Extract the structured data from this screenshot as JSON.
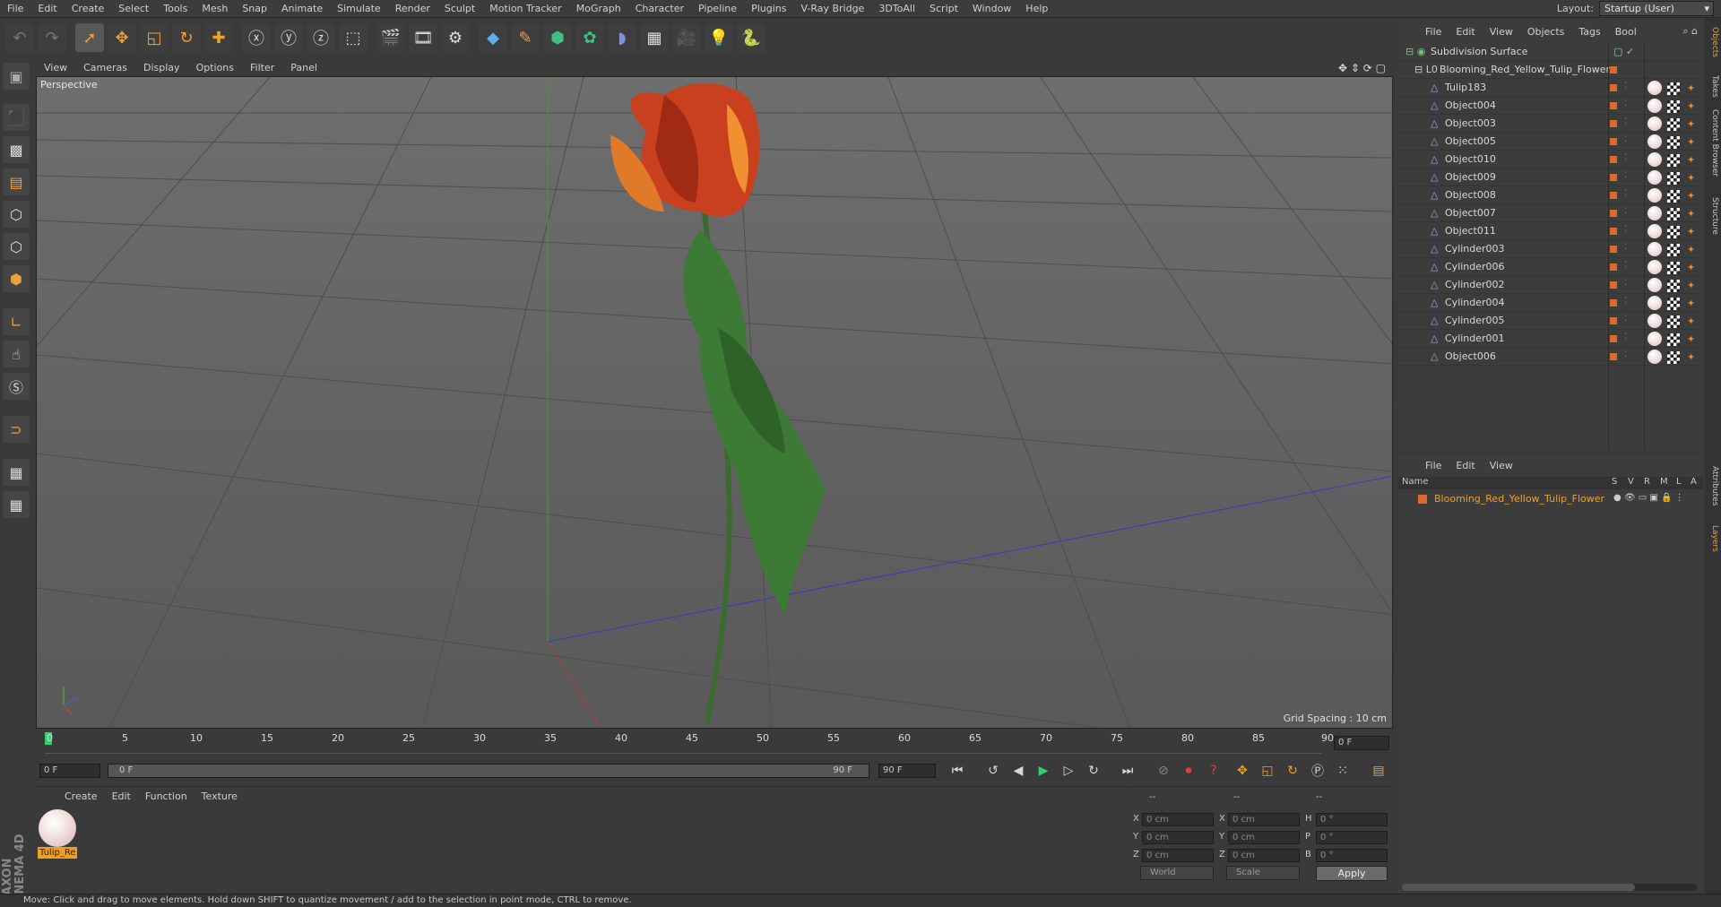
{
  "menubar": {
    "items": [
      "File",
      "Edit",
      "Create",
      "Select",
      "Tools",
      "Mesh",
      "Snap",
      "Animate",
      "Simulate",
      "Render",
      "Sculpt",
      "Motion Tracker",
      "MoGraph",
      "Character",
      "Pipeline",
      "Plugins",
      "V-Ray Bridge",
      "3DToAll",
      "Script",
      "Window",
      "Help"
    ],
    "layout_label": "Layout:",
    "layout_value": "Startup (User)"
  },
  "viewport": {
    "menu": [
      "View",
      "Cameras",
      "Display",
      "Options",
      "Filter",
      "Panel"
    ],
    "label": "Perspective",
    "grid_spacing": "Grid Spacing : 10 cm"
  },
  "timeline": {
    "ticks": [
      "0",
      "5",
      "10",
      "15",
      "20",
      "25",
      "30",
      "35",
      "40",
      "45",
      "50",
      "55",
      "60",
      "65",
      "70",
      "75",
      "80",
      "85",
      "90"
    ],
    "current_frame": "0 F",
    "start_field": "0 F",
    "range_start": "0 F",
    "range_end": "90 F",
    "end_field": "90 F"
  },
  "material_manager": {
    "menu": [
      "Create",
      "Edit",
      "Function",
      "Texture"
    ],
    "material_name": "Tulip_Re"
  },
  "coordinates": {
    "headers": [
      "--",
      "--",
      "--"
    ],
    "rows": [
      {
        "l1": "X",
        "v1": "0 cm",
        "l2": "X",
        "v2": "0 cm",
        "l3": "H",
        "v3": "0 °"
      },
      {
        "l1": "Y",
        "v1": "0 cm",
        "l2": "Y",
        "v2": "0 cm",
        "l3": "P",
        "v3": "0 °"
      },
      {
        "l1": "Z",
        "v1": "0 cm",
        "l2": "Z",
        "v2": "0 cm",
        "l3": "B",
        "v3": "0 °"
      }
    ],
    "world": "World",
    "scale": "Scale",
    "apply": "Apply"
  },
  "object_manager": {
    "menu": [
      "File",
      "Edit",
      "View",
      "Objects",
      "Tags",
      "Bool"
    ],
    "root": "Subdivision Surface",
    "group": "Blooming_Red_Yellow_Tulip_Flower",
    "children": [
      "Tulip183",
      "Object004",
      "Object003",
      "Object005",
      "Object010",
      "Object009",
      "Object008",
      "Object007",
      "Object011",
      "Cylinder003",
      "Cylinder006",
      "Cylinder002",
      "Cylinder004",
      "Cylinder005",
      "Cylinder001",
      "Object006"
    ]
  },
  "layer_manager": {
    "menu": [
      "File",
      "Edit",
      "View"
    ],
    "columns": [
      "Name",
      "S",
      "V",
      "R",
      "M",
      "L",
      "A"
    ],
    "layer_name": "Blooming_Red_Yellow_Tulip_Flower"
  },
  "side_tabs": [
    "Objects",
    "Takes",
    "Content Browser",
    "Structure",
    "Attributes",
    "Layers"
  ],
  "status": "Move: Click and drag to move elements. Hold down SHIFT to quantize movement / add to the selection in point mode, CTRL to remove.",
  "brand": "MAXON CINEMA 4D",
  "colors": {
    "accent": "#f0a020",
    "layer_color": "#d86a2a"
  }
}
